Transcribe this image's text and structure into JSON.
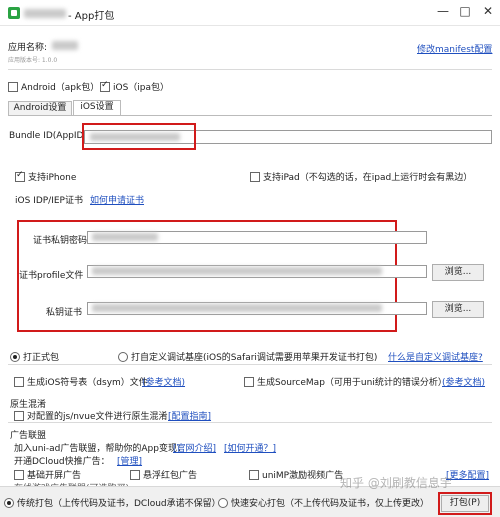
{
  "window": {
    "title": "- App打包",
    "minimize": "—",
    "maximize": "□",
    "close": "✕"
  },
  "app": {
    "name_label": "应用名称:",
    "version_label": "应用版本号: 1.0.0",
    "modify_manifest": "修改manifest配置"
  },
  "platforms": {
    "android": "Android（apk包）",
    "ios": "iOS（ipa包）",
    "android_checked": false,
    "ios_checked": true
  },
  "tabs": [
    {
      "label": "Android设置"
    },
    {
      "label": "iOS设置"
    }
  ],
  "bundle": {
    "label": "Bundle ID(AppID)"
  },
  "devices": {
    "iphone": "支持iPhone",
    "ipad": "支持iPad（不勾选的话，在ipad上运行时会有黑边）"
  },
  "cert": {
    "section_label": "iOS IDP/IEP证书",
    "apply_link": "如何申请证书",
    "password_label": "证书私钥密码",
    "profile_label": "证书profile文件",
    "private_cert_label": "私钥证书",
    "browse1": "浏览...",
    "browse2": "浏览..."
  },
  "build_mode": {
    "formal": "打正式包",
    "custom": "打自定义调试基座(iOS的Safari调试需要用苹果开发证书打包)",
    "what_is_custom": "什么是自定义调试基座?"
  },
  "options": {
    "dsym": "生成iOS符号表（dsym）文件",
    "dsym_ref": "(参考文档)",
    "sourcemap": "生成SourceMap（可用于uni统计的错误分析）",
    "sourcemap_ref": "(参考文档)"
  },
  "native": {
    "section": "原生混淆",
    "confusion": "对配置的js/nvue文件进行原生混淆",
    "config_guide": "[配置指南]"
  },
  "ads": {
    "section": "广告联盟",
    "join_text": "加入uni-ad广告联盟，帮助你的App变现：",
    "official_link": "[官网介绍]",
    "how_enable": "[如何开通？]",
    "dcloud_text": "开通DCloud快推广告：",
    "manage_link": "[管理]",
    "splash": "基础开屏广告",
    "float": "悬浮红包广告",
    "unimp": "uniMP激励视频广告",
    "more": "[更多配置]",
    "cut_text": "在线游戏广告联盟(可选购买)"
  },
  "footer": {
    "traditional": "传统打包（上传代码及证书，DCloud承诺不保留）",
    "fast": "快速安心打包（不上传代码及证书，仅上传更改）",
    "pack_button": "打包(P)",
    "watermark": "知乎 @刘刷教信息宇"
  }
}
